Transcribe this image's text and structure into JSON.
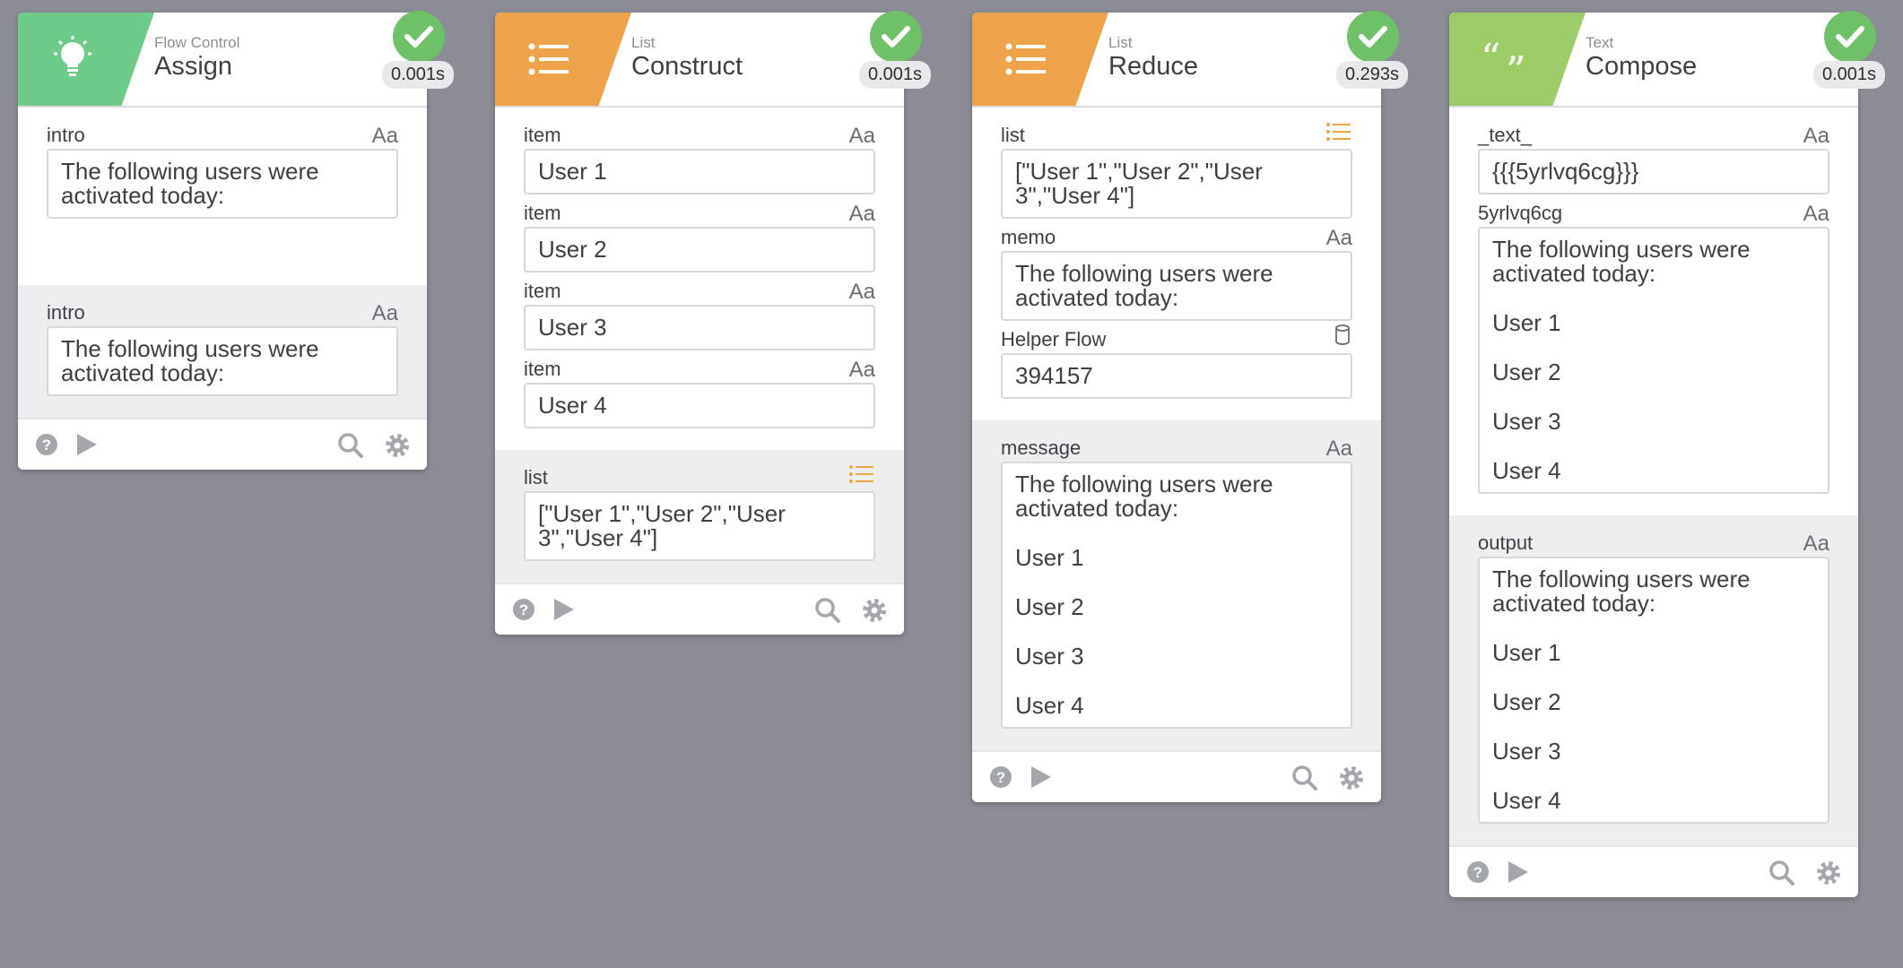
{
  "cards": [
    {
      "category": "Flow Control",
      "name": "Assign",
      "time": "0.001s",
      "inputs": [
        {
          "label": "intro",
          "type": "Aa",
          "lines": [
            "The following users were",
            "activated today:"
          ]
        }
      ],
      "outputs": [
        {
          "label": "intro",
          "type": "Aa",
          "lines": [
            "The following users were",
            "activated today:"
          ]
        }
      ]
    },
    {
      "category": "List",
      "name": "Construct",
      "time": "0.001s",
      "inputs": [
        {
          "label": "item",
          "type": "Aa",
          "lines": [
            "User 1"
          ]
        },
        {
          "label": "item",
          "type": "Aa",
          "lines": [
            "User 2"
          ]
        },
        {
          "label": "item",
          "type": "Aa",
          "lines": [
            "User 3"
          ]
        },
        {
          "label": "item",
          "type": "Aa",
          "lines": [
            "User 4"
          ]
        }
      ],
      "outputs": [
        {
          "label": "list",
          "type": "list",
          "lines": [
            "[\"User 1\",\"User 2\",\"User",
            "3\",\"User 4\"]"
          ]
        }
      ]
    },
    {
      "category": "List",
      "name": "Reduce",
      "time": "0.293s",
      "inputs": [
        {
          "label": "list",
          "type": "list",
          "lines": [
            "[\"User 1\",\"User 2\",\"User",
            "3\",\"User 4\"]"
          ]
        },
        {
          "label": "memo",
          "type": "Aa",
          "lines": [
            "The following users were",
            "activated today:"
          ]
        },
        {
          "label": "Helper Flow",
          "type": "flow",
          "lines": [
            "394157"
          ]
        }
      ],
      "outputs": [
        {
          "label": "message",
          "type": "Aa",
          "lines": [
            "The following users were",
            "activated today:",
            "",
            "User 1",
            "",
            "User 2",
            "",
            "User 3",
            "",
            "User 4"
          ]
        }
      ]
    },
    {
      "category": "Text",
      "name": "Compose",
      "time": "0.001s",
      "inputs": [
        {
          "label": "_text_",
          "type": "Aa",
          "lines": [
            "{{{5yrlvq6cg}}}"
          ]
        },
        {
          "label": "5yrlvq6cg",
          "type": "Aa",
          "lines": [
            "The following users were",
            "activated today:",
            "",
            "User 1",
            "",
            "User 2",
            "",
            "User 3",
            "",
            "User 4"
          ]
        }
      ],
      "outputs": [
        {
          "label": "output",
          "type": "Aa",
          "lines": [
            "The following users were",
            "activated today:",
            "",
            "User 1",
            "",
            "User 2",
            "",
            "User 3",
            "",
            "User 4"
          ]
        }
      ]
    }
  ],
  "colors": {
    "assign": "#6ccb86",
    "list": "#eea24a",
    "text": "#9ccd67",
    "success": "#6cc265",
    "list_icon": "#f0a640"
  },
  "icons": {
    "assign": "lightbulb-icon",
    "construct": "list-icon",
    "reduce": "list-icon",
    "compose": "quote-icon",
    "status": "checkmark-icon",
    "help": "help-icon",
    "run": "play-icon",
    "search": "search-icon",
    "settings": "gear-icon",
    "type_text": "text-type-icon",
    "type_list": "list-type-icon",
    "type_flow": "database-icon"
  }
}
